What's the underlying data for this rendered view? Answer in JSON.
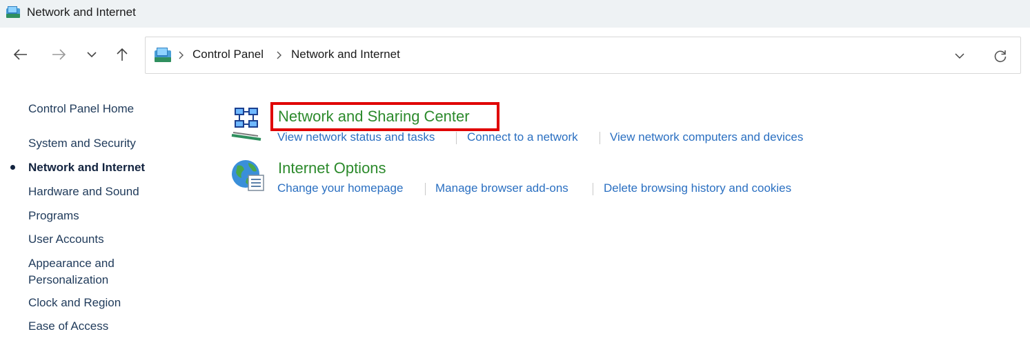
{
  "window": {
    "title": "Network and Internet",
    "icon": "network-folder-icon"
  },
  "navigation": {
    "back_icon": "arrow-left-icon",
    "forward_icon": "arrow-right-icon",
    "recent_icon": "chevron-down-icon",
    "up_icon": "arrow-up-icon"
  },
  "address_bar": {
    "location_icon": "network-folder-icon",
    "breadcrumbs": [
      "Control Panel",
      "Network and Internet"
    ],
    "dropdown_icon": "chevron-down-icon",
    "refresh_icon": "refresh-icon"
  },
  "sidebar": {
    "items": [
      {
        "label": "Control Panel Home",
        "active": false
      },
      {
        "label": "System and Security",
        "active": false
      },
      {
        "label": "Network and Internet",
        "active": true
      },
      {
        "label": "Hardware and Sound",
        "active": false
      },
      {
        "label": "Programs",
        "active": false
      },
      {
        "label": "User Accounts",
        "active": false
      },
      {
        "label": "Appearance and",
        "label2": "Personalization",
        "active": false
      },
      {
        "label": "Clock and Region",
        "active": false
      },
      {
        "label": "Ease of Access",
        "active": false
      }
    ]
  },
  "categories": [
    {
      "title": "Network and Sharing Center",
      "icon": "network-sharing-icon",
      "links": [
        "View network status and tasks",
        "Connect to a network",
        "View network computers and devices"
      ]
    },
    {
      "title": "Internet Options",
      "icon": "internet-options-globe-icon",
      "links": [
        "Change your homepage",
        "Manage browser add-ons",
        "Delete browsing history and cookies"
      ]
    }
  ],
  "colors": {
    "category_title": "#2c8a2c",
    "link": "#2a6fc1",
    "highlight": "#e00000",
    "titlebar_bg": "#eef2f4"
  }
}
